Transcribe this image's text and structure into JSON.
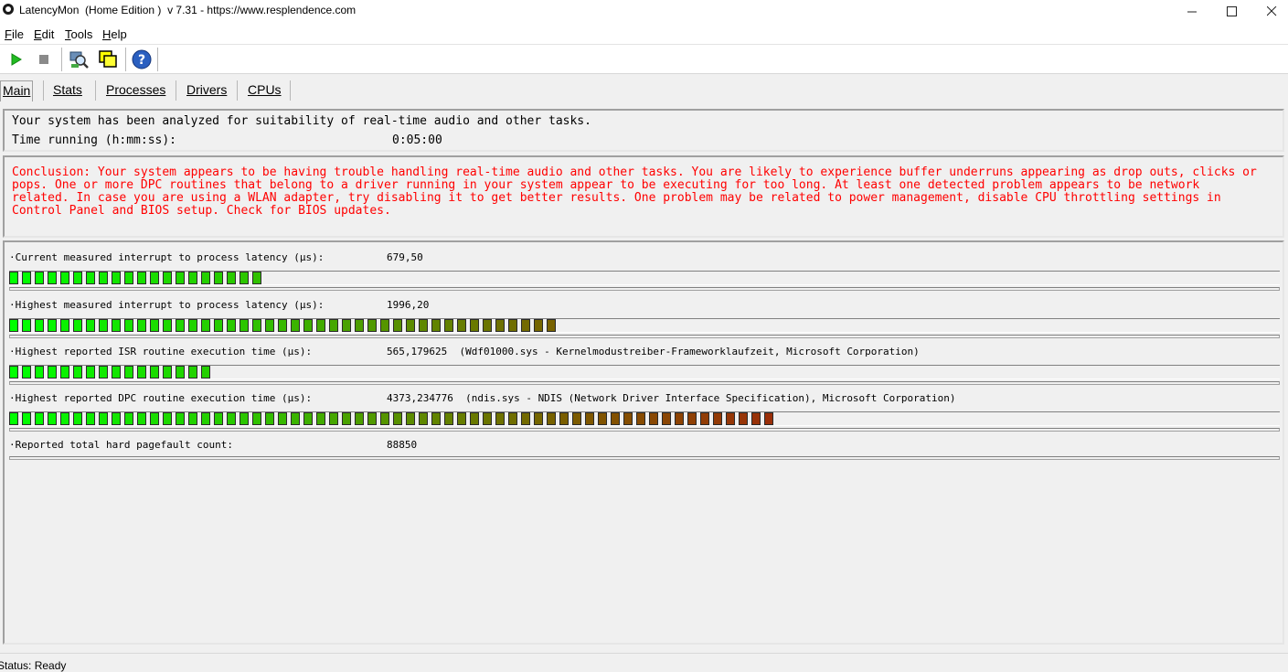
{
  "window": {
    "title": "LatencyMon  (Home Edition )  v 7.31 - https://www.resplendence.com"
  },
  "menu": {
    "file_initial": "F",
    "file_rest": "ile",
    "edit_initial": "E",
    "edit_rest": "dit",
    "tools_initial": "T",
    "tools_rest": "ools",
    "help_initial": "H",
    "help_rest": "elp"
  },
  "toolbar": {
    "icons": [
      "play-icon",
      "stop-icon",
      "driver-search-icon",
      "windows-icon",
      "help-icon"
    ]
  },
  "tabs": [
    {
      "label": "Main",
      "active": true
    },
    {
      "label": "Stats"
    },
    {
      "label": "Processes"
    },
    {
      "label": "Drivers"
    },
    {
      "label": "CPUs"
    }
  ],
  "summary": {
    "line1": "Your system has been analyzed for suitability of real-time audio and other tasks.",
    "time_label": "Time running (h:mm:ss):",
    "time_value": "0:05:00"
  },
  "conclusion": "Conclusion: Your system appears to be having trouble handling real-time audio and other tasks. You are likely to experience buffer underruns appearing as drop outs, clicks or pops. One or more DPC routines that belong to a driver running in your system appear to be executing for too long. At least one detected problem appears to be network related. In case you are using a WLAN adapter, try disabling it to get better results. One problem may be related to power management, disable CPU throttling settings in Control Panel and BIOS setup. Check for BIOS updates.",
  "colors": {
    "conclusion_text": "#ff0000",
    "bar_green": "#00ff00",
    "bar_red": "#b01010"
  },
  "metrics": [
    {
      "label": "·Current measured interrupt to process latency (µs):",
      "value": "679,50",
      "bar_segments": 20
    },
    {
      "label": "·Highest measured interrupt to process latency (µs):",
      "value": "1996,20",
      "bar_segments": 43
    },
    {
      "label": "·Highest reported ISR routine execution time (µs):",
      "value": "565,179625  (Wdf01000.sys - Kernelmodustreiber-Frameworklaufzeit, Microsoft Corporation)",
      "bar_segments": 16
    },
    {
      "label": "·Highest reported DPC routine execution time (µs):",
      "value": "4373,234776  (ndis.sys - NDIS (Network Driver Interface Specification), Microsoft Corporation)",
      "bar_segments": 60
    },
    {
      "label": "·Reported total hard pagefault count:",
      "value": "88850",
      "bar_segments": 0
    }
  ],
  "status": {
    "text": "Status: Ready"
  }
}
